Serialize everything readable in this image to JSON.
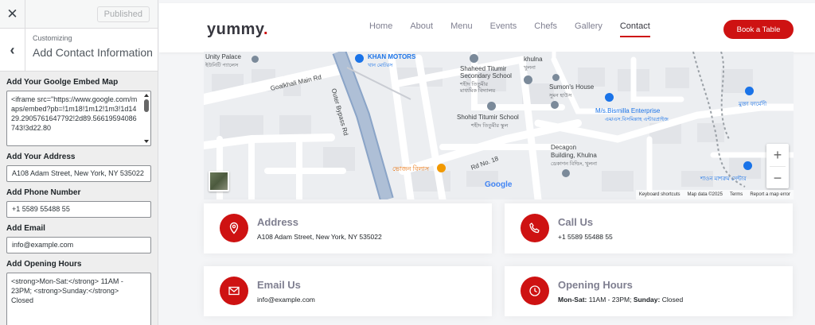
{
  "customizer": {
    "close_symbol": "✕",
    "publish_label": "Published",
    "back_symbol": "‹",
    "customizing_label": "Customizing",
    "section_title": "Add Contact Information",
    "fields": {
      "map": {
        "label": "Add Your Goolge Embed Map",
        "value": "<iframe src=\"https://www.google.com/maps/embed?pb=!1m18!1m12!1m3!1d1429.2905761647792!2d89.56619594086743!3d22.80"
      },
      "address": {
        "label": "Add Your Address",
        "value": "A108 Adam Street, New York, NY 535022"
      },
      "phone": {
        "label": "Add Phone Number",
        "value": "+1 5589 55488 55"
      },
      "email": {
        "label": "Add Email",
        "value": "info@example.com"
      },
      "hours": {
        "label": "Add Opening Hours",
        "value": "<strong>Mon-Sat:</strong> 11AM - 23PM; <strong>Sunday:</strong> Closed"
      }
    }
  },
  "site": {
    "logo_text": "yummy",
    "logo_dot": ".",
    "nav": [
      "Home",
      "About",
      "Menu",
      "Events",
      "Chefs",
      "Gallery",
      "Contact"
    ],
    "active_nav": "Contact",
    "book_button": "Book a Table",
    "colors": {
      "accent": "#ce1212",
      "heading": "#37373f",
      "muted": "#7f7f90"
    }
  },
  "map": {
    "labels": {
      "unity_palace": "Unity Palace",
      "unity_palace_bn": "ইউনিটি প্যালেস",
      "khan_motors": "KHAN MOTORS",
      "khan_motors_bn": "খান মোটরস",
      "goalkhali": "Goalkhali Main Rd",
      "outer_bypass": "Outer Bypass Rd",
      "shaheed_school_1": "Shaheed Titumir",
      "shaheed_school_2": "Secondary School",
      "shaheed_school_bn1": "শহীদ তিতুমীর",
      "shaheed_school_bn2": "মাধ্যমিক বিদ্যালয়",
      "khulna": "khulna",
      "khulna_bn": "খুলনা",
      "sumons_house": "Sumon's House",
      "sumons_house_bn": "সুমন হাউস",
      "shohid_school": "Shohid Titumir School",
      "shohid_school_bn": "শহীদ তিতুমীর স্কুল",
      "bismilla_1": "M/s.Bismilla Enterprise",
      "bismilla_bn": "এম/এস.বিসমিল্লাহ এন্টারপ্রাইজ",
      "mukta_pharmacy": "মুক্তা ফার্মেসী",
      "decagon_1": "Decagon",
      "decagon_2": "Building, Khulna",
      "decagon_bn": "ডেকাগন বিল্ডিং, খুলনা",
      "bhojon_bilash": "ভোজন বিলাস",
      "rd_no_18": "Rd No. 18",
      "shaon": "শাওন মাশরুম সেন্টার",
      "google": "Google"
    },
    "zoom_in": "+",
    "zoom_out": "−",
    "footer": [
      "Keyboard shortcuts",
      "Map data ©2025",
      "Terms",
      "Report a map error"
    ]
  },
  "cards": [
    {
      "title": "Address",
      "text": "A108 Adam Street, New York, NY 535022",
      "icon": "map-pin-icon"
    },
    {
      "title": "Call Us",
      "text": "+1 5589 55488 55",
      "icon": "phone-icon"
    },
    {
      "title": "Email Us",
      "text": "info@example.com",
      "icon": "envelope-icon"
    },
    {
      "title": "Opening Hours",
      "hours_day_label": "Mon-Sat:",
      "hours_day_value": "11AM - 23PM;",
      "hours_sun_label": "Sunday:",
      "hours_sun_value": "Closed",
      "icon": "clock-icon"
    }
  ]
}
